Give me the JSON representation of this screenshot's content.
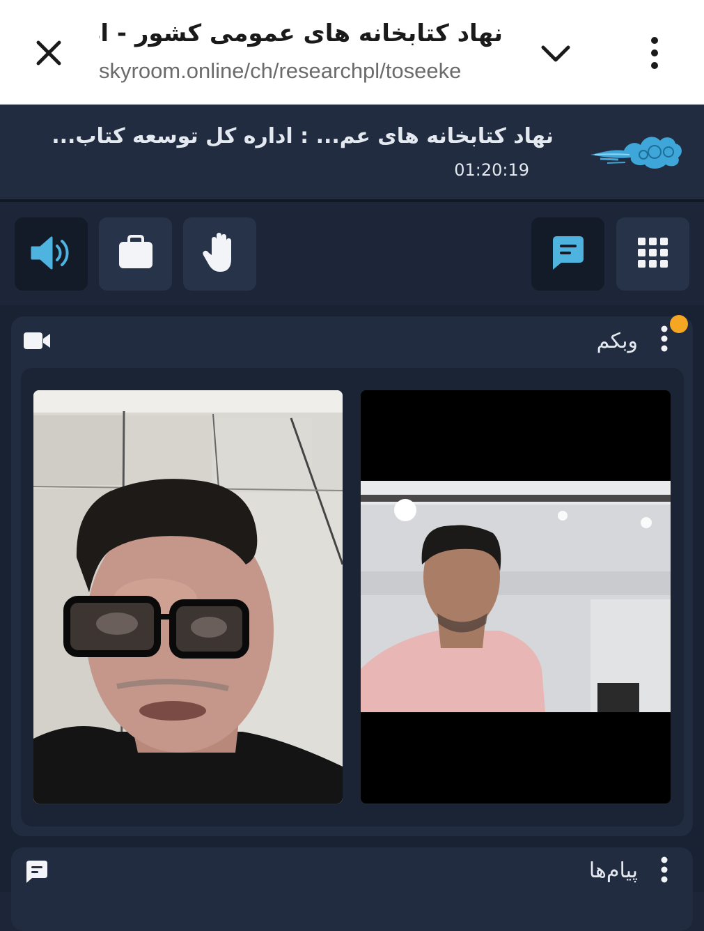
{
  "browser": {
    "title": "نهاد کتابخانه های عمومی کشور - اداره کل توسعه کتابخانه ها",
    "url": "skyroom.online/ch/researchpl/toseeke",
    "close_icon": "close-icon",
    "expand_icon": "chevron-down-icon",
    "menu_icon": "more-vertical-icon"
  },
  "session": {
    "title": "نهاد کتابخانه های عم...   :  اداره کل توسعه کتاب...",
    "timer": "01:20:19",
    "logo_icon": "skyroom-cloud-logo"
  },
  "toolbar": {
    "buttons": [
      {
        "name": "speaker",
        "icon": "speaker-volume-icon",
        "active": true
      },
      {
        "name": "briefcase",
        "icon": "briefcase-icon"
      },
      {
        "name": "raise-hand",
        "icon": "hand-icon"
      },
      {
        "name": "chat",
        "icon": "chat-bubble-icon",
        "active": true
      },
      {
        "name": "apps",
        "icon": "grid-icon"
      }
    ]
  },
  "webcam_panel": {
    "title": "وبکم",
    "icon": "video-camera-icon",
    "menu_icon": "more-vertical-icon",
    "notification": true
  },
  "messages_panel": {
    "title": "پیام‌ها",
    "icon": "chat-bubble-icon",
    "menu_icon": "more-vertical-icon"
  },
  "colors": {
    "accent": "#4fb3e0",
    "header_bg": "#212c40",
    "panel_bg": "#212c40",
    "notify": "#f5a623"
  }
}
